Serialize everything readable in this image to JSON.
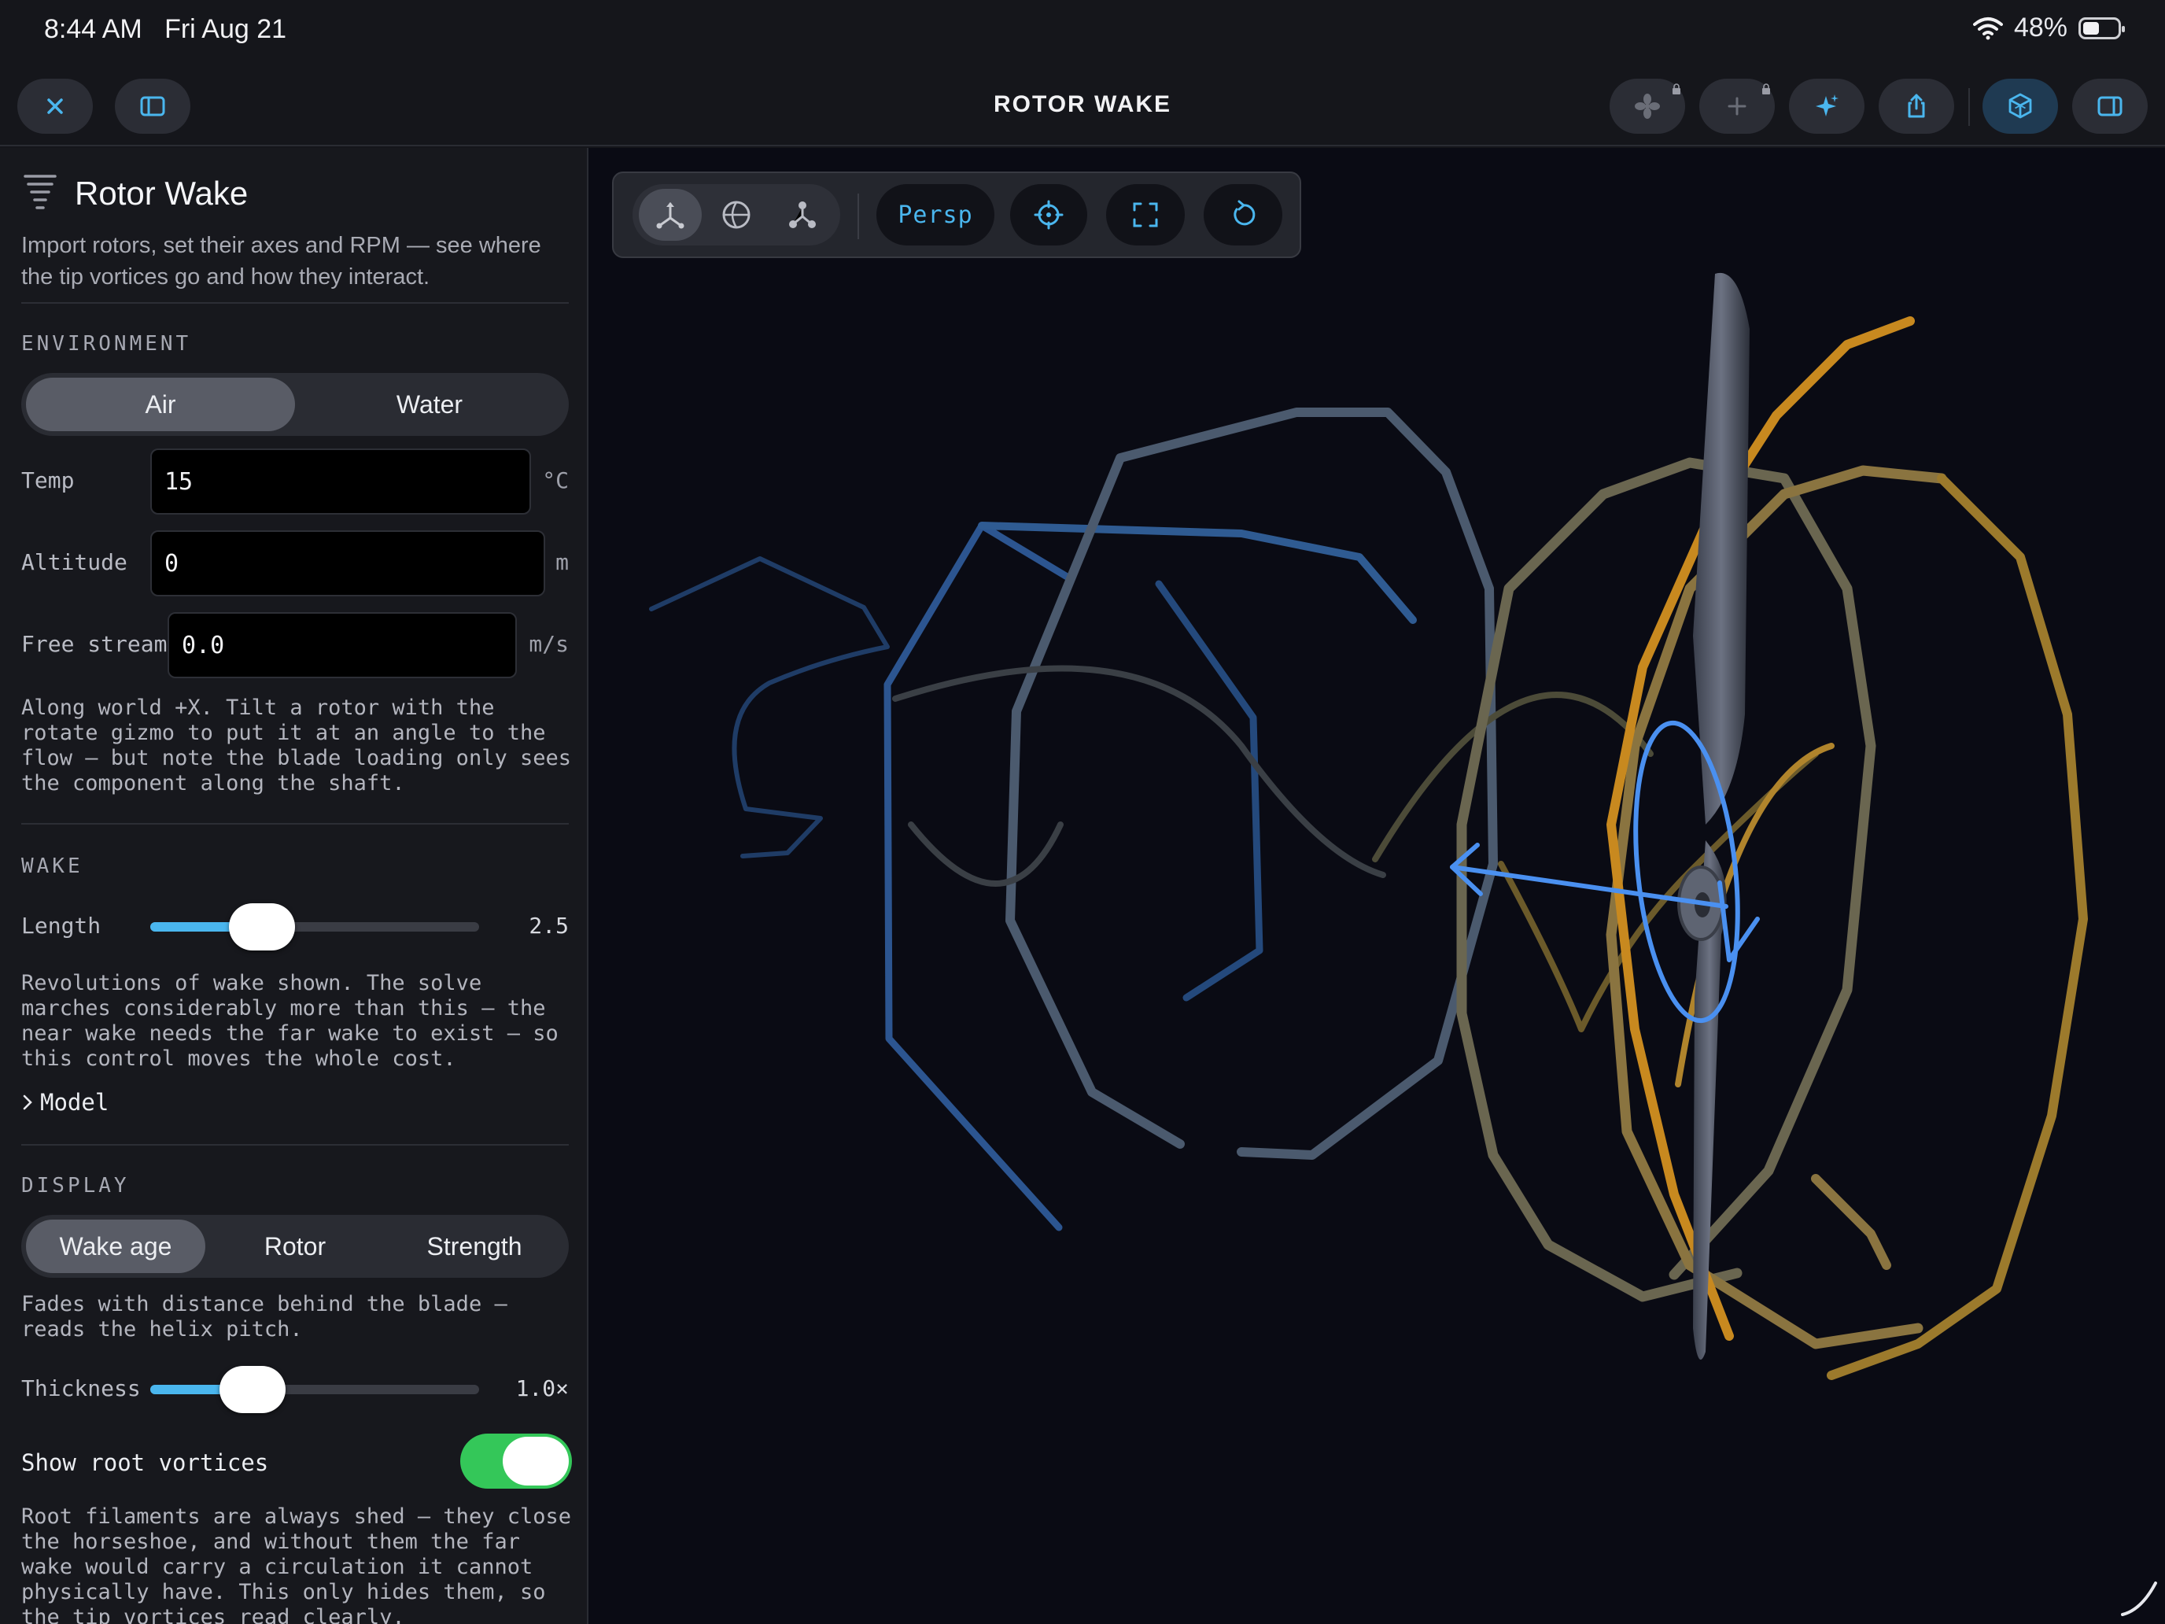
{
  "status_bar": {
    "time": "8:44 AM",
    "date": "Fri Aug 21",
    "battery": "48%",
    "battery_level": 0.48
  },
  "toolbar": {
    "title": "ROTOR WAKE"
  },
  "sidebar": {
    "title": "Rotor Wake",
    "subtitle": "Import rotors, set their axes and RPM — see where the tip vortices go and how they interact.",
    "environment": {
      "title": "ENVIRONMENT",
      "options": [
        "Air",
        "Water"
      ],
      "selected": "Air",
      "temp": {
        "label": "Temp",
        "value": "15",
        "unit": "°C"
      },
      "altitude": {
        "label": "Altitude",
        "value": "0",
        "unit": "m"
      },
      "free_stream": {
        "label": "Free stream",
        "value": "0.0",
        "unit": "m/s"
      },
      "help": "Along world +X. Tilt a rotor with the rotate gizmo to put it at an angle to the flow — but note the blade loading only sees the component along the shaft."
    },
    "wake": {
      "title": "WAKE",
      "length": {
        "label": "Length",
        "value": "2.5",
        "fraction": 0.34
      },
      "help": "Revolutions of wake shown. The solve marches considerably more than this — the near wake needs the far wake to exist — so this control moves the whole cost.",
      "model_label": "Model"
    },
    "display": {
      "title": "DISPLAY",
      "options": [
        "Wake age",
        "Rotor",
        "Strength"
      ],
      "selected": "Wake age",
      "help": "Fades with distance behind the blade — reads the helix pitch.",
      "thickness": {
        "label": "Thickness",
        "value": "1.0×",
        "fraction": 0.31
      },
      "root_vortices": {
        "label": "Show root vortices",
        "on": true
      },
      "root_help": "Root filaments are always shed — they close the horseshoe, and without them the far wake would carry a circulation it cannot physically have. This only hides them, so the tip vortices read clearly."
    }
  },
  "viewport": {
    "projection_label": "Persp",
    "colors": {
      "near_wake": "#c8891f",
      "far_wake": "#2f5b92",
      "gizmo": "#4a90f0",
      "accent": "#4ab6ee"
    }
  }
}
